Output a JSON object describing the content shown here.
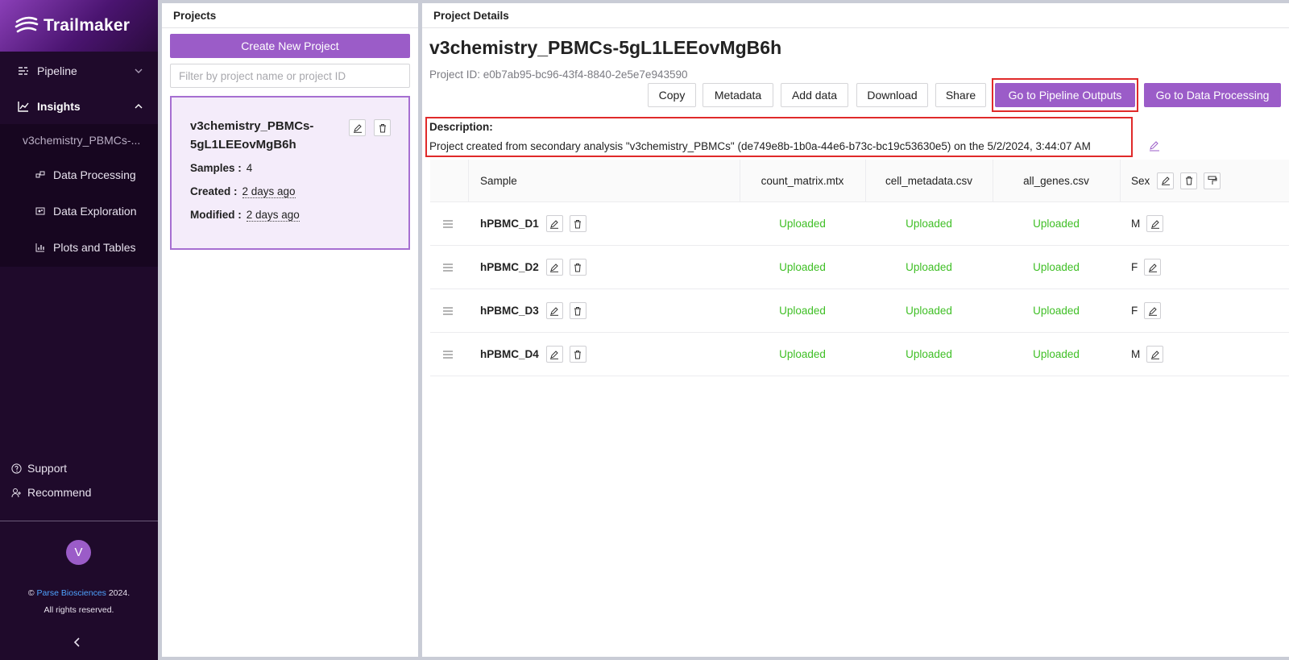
{
  "app": {
    "name": "Trailmaker"
  },
  "sidebar": {
    "pipeline_label": "Pipeline",
    "insights_label": "Insights",
    "current_project": "v3chemistry_PBMCs-...",
    "sub_items": [
      {
        "label": "Data Processing",
        "icon": "data-processing-icon"
      },
      {
        "label": "Data Exploration",
        "icon": "data-exploration-icon"
      },
      {
        "label": "Plots and Tables",
        "icon": "bar-chart-icon"
      }
    ],
    "support_label": "Support",
    "recommend_label": "Recommend",
    "avatar_initial": "V",
    "copyright_prefix": "©",
    "copyright_company": "Parse Biosciences",
    "copyright_year": "2024.",
    "rights": "All rights reserved."
  },
  "projects_panel": {
    "title": "Projects",
    "create_button": "Create New Project",
    "filter_placeholder": "Filter by project name or project ID",
    "card": {
      "title_line1": "v3chemistry_PBMCs-",
      "title_line2": "5gL1LEEovMgB6h",
      "samples_label": "Samples :",
      "samples_value": "4",
      "created_label": "Created :",
      "created_value": "2 days ago",
      "modified_label": "Modified :",
      "modified_value": "2 days ago"
    }
  },
  "details_panel": {
    "title": "Project Details",
    "project_name": "v3chemistry_PBMCs-5gL1LEEovMgB6h",
    "project_id": "Project ID: e0b7ab95-bc96-43f4-8840-2e5e7e943590",
    "buttons": {
      "copy": "Copy",
      "metadata": "Metadata",
      "add_data": "Add data",
      "download": "Download",
      "share": "Share",
      "pipeline_outputs": "Go to Pipeline Outputs",
      "data_processing": "Go to Data Processing"
    },
    "description_label": "Description:",
    "description_text": "Project created from secondary analysis \"v3chemistry_PBMCs\" (de749e8b-1b0a-44e6-b73c-bc19c53630e5) on the 5/2/2024, 3:44:07 AM",
    "table": {
      "headers": {
        "sample": "Sample",
        "count_matrix": "count_matrix.mtx",
        "cell_metadata": "cell_metadata.csv",
        "all_genes": "all_genes.csv",
        "sex": "Sex"
      },
      "rows": [
        {
          "sample": "hPBMC_D1",
          "count_matrix": "Uploaded",
          "cell_metadata": "Uploaded",
          "all_genes": "Uploaded",
          "sex": "M"
        },
        {
          "sample": "hPBMC_D2",
          "count_matrix": "Uploaded",
          "cell_metadata": "Uploaded",
          "all_genes": "Uploaded",
          "sex": "F"
        },
        {
          "sample": "hPBMC_D3",
          "count_matrix": "Uploaded",
          "cell_metadata": "Uploaded",
          "all_genes": "Uploaded",
          "sex": "F"
        },
        {
          "sample": "hPBMC_D4",
          "count_matrix": "Uploaded",
          "cell_metadata": "Uploaded",
          "all_genes": "Uploaded",
          "sex": "M"
        }
      ]
    }
  },
  "colors": {
    "accent": "#9b5cc8",
    "sidebar_bg": "#1f0a2b",
    "uploaded_green": "#3fbf25",
    "highlight_red": "#e02a2a"
  }
}
